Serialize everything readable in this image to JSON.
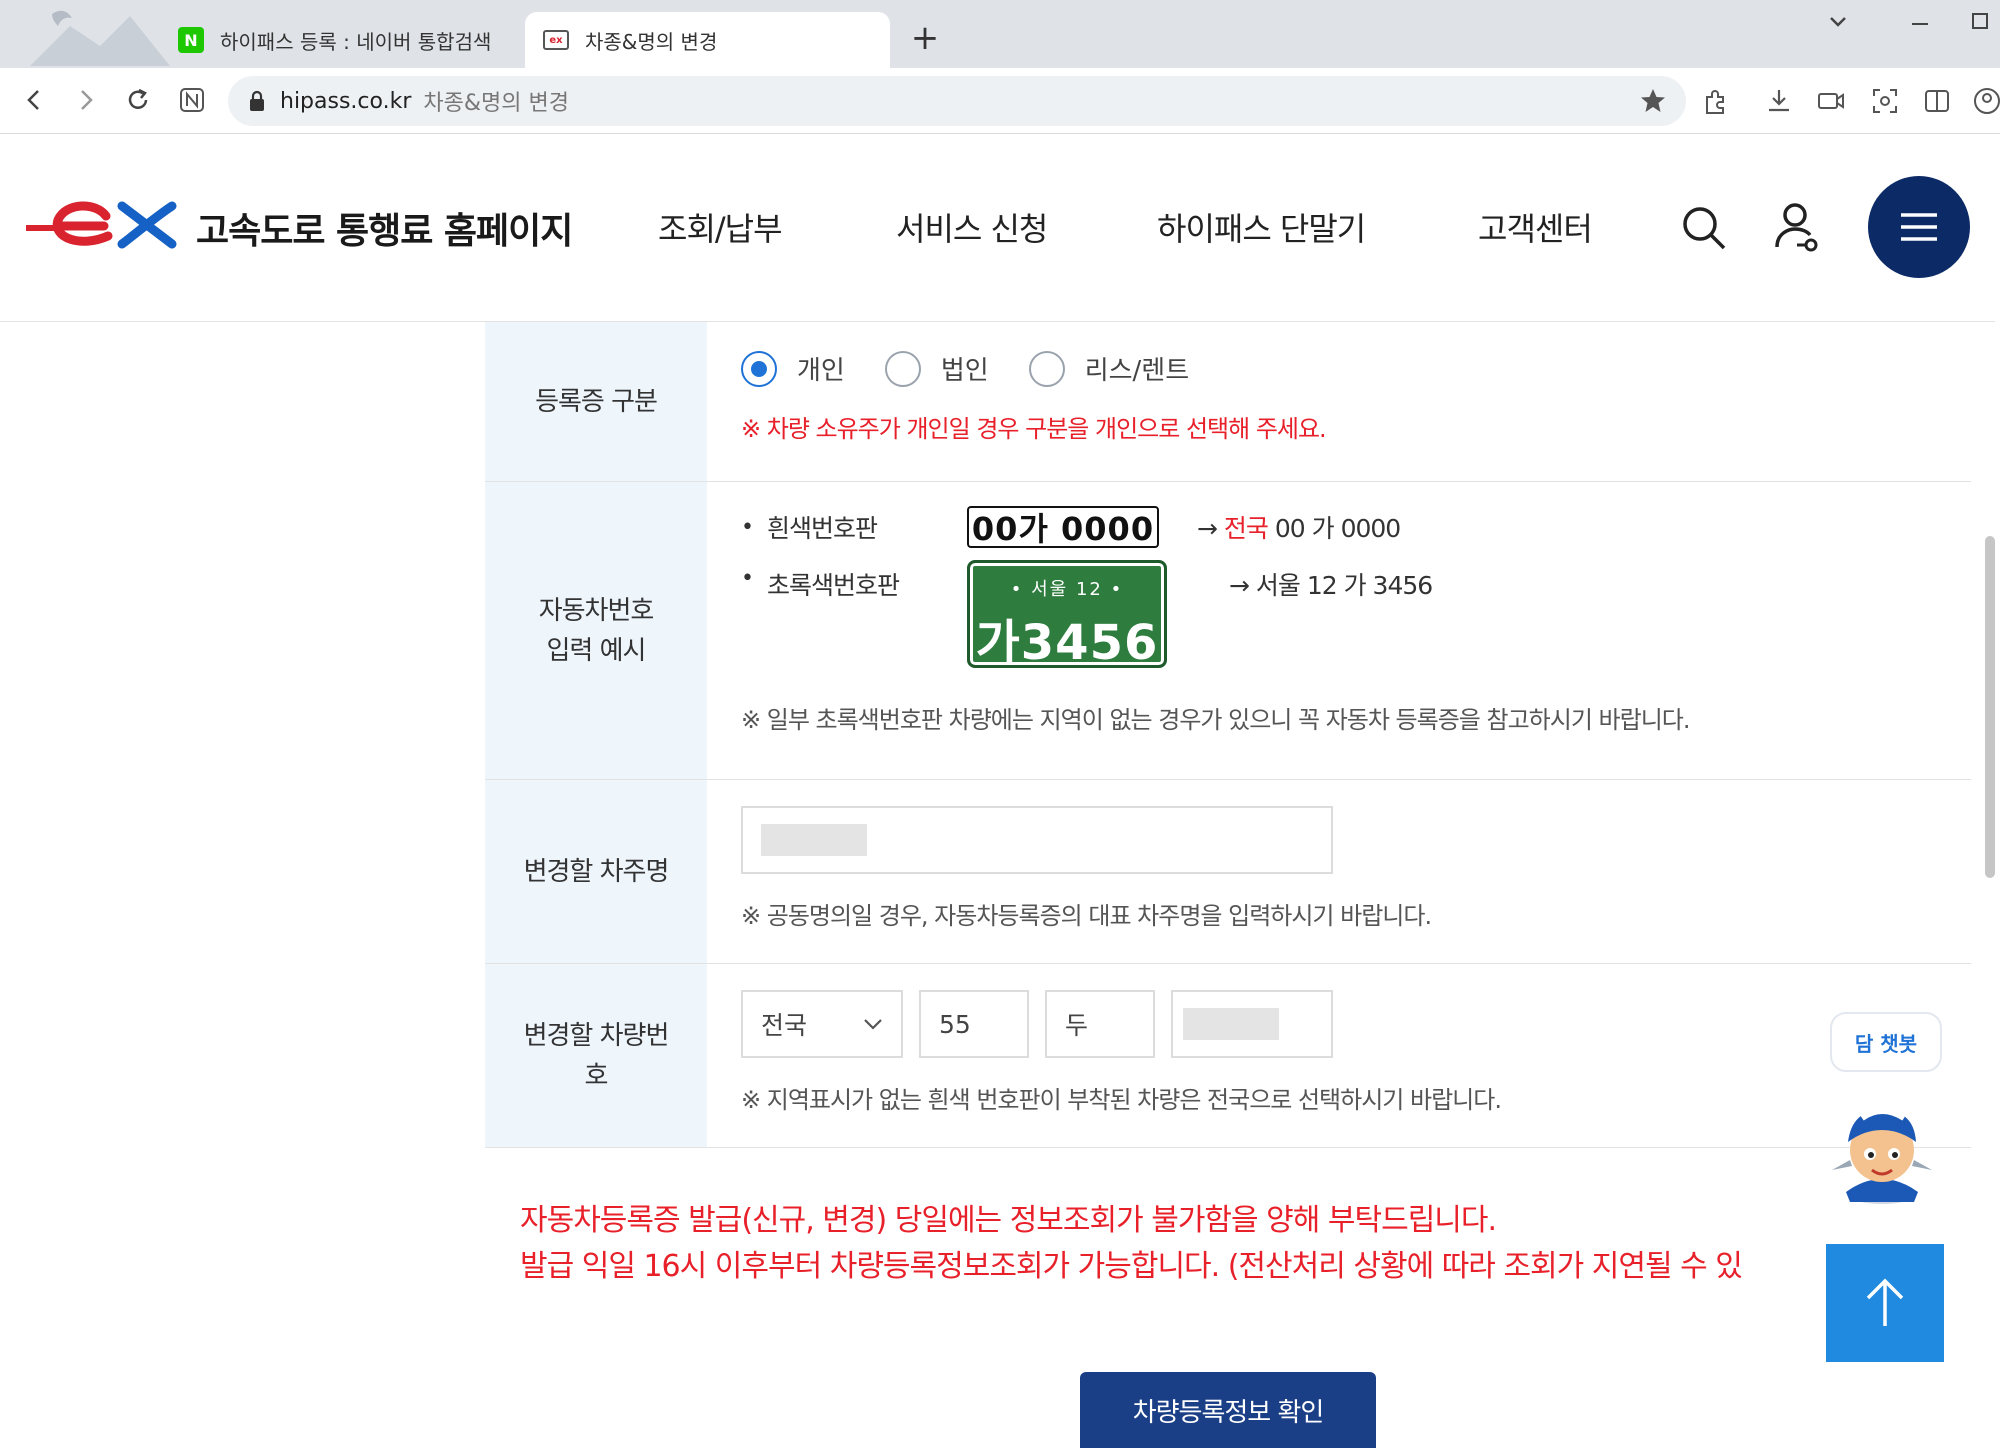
{
  "browser": {
    "tabs": [
      {
        "title": "하이패스 등록 : 네이버 통합검색",
        "favicon": "naver-icon",
        "active": false
      },
      {
        "title": "차종&명의 변경",
        "favicon": "ex-logo-icon",
        "active": true
      }
    ],
    "new_tab": "+",
    "address": {
      "host": "hipass.co.kr",
      "path": "차종&명의 변경"
    }
  },
  "header": {
    "site_title": "고속도로 통행료 홈페이지",
    "nav": [
      "조회/납부",
      "서비스 신청",
      "하이패스 단말기",
      "고객센터"
    ],
    "icons": [
      "search-icon",
      "user-icon",
      "hamburger-menu-icon"
    ],
    "brand_color": "#0c2a66"
  },
  "form": {
    "reg_type": {
      "label": "등록증 구분",
      "options": [
        {
          "label": "개인",
          "checked": true
        },
        {
          "label": "법인",
          "checked": false
        },
        {
          "label": "리스/렌트",
          "checked": false
        }
      ],
      "warning": "※ 차량 소유주가 개인일 경우 구분을 개인으로 선택해 주세요."
    },
    "plate_example": {
      "label_line1": "자동차번호",
      "label_line2": "입력 예시",
      "white": {
        "bullet": "•",
        "label": "흰색번호판",
        "plate": "00가 0000",
        "arrow": "→",
        "result_region": "전국",
        "result_rest": " 00 가 0000"
      },
      "green": {
        "bullet": "•",
        "label": "초록색번호판",
        "plate_top": "• 서울 12 •",
        "plate_bottom": "가3456",
        "arrow": "→",
        "result": " 서울 12 가 3456"
      },
      "note": "※ 일부 초록색번호판 차량에는 지역이 없는 경우가 있으니 꼭 자동차 등록증을 참고하시기 바랍니다."
    },
    "owner": {
      "label": "변경할 차주명",
      "note": "※ 공동명의일 경우, 자동차등록증의 대표 차주명을 입력하시기 바랍니다."
    },
    "vehicle_no": {
      "label_line1": "변경할 차량번",
      "label_line2": "호",
      "region": "전국",
      "num1": "55",
      "hangul": "두",
      "note": "※ 지역표시가 없는 흰색 번호판이 부착된 차량은 전국으로 선택하시기 바랍니다."
    }
  },
  "notice": {
    "line1": "자동차등록증 발급(신규, 변경) 당일에는 정보조회가 불가함을 양해 부탁드립니다.",
    "line2": "발급 익일 16시 이후부터 차량등록정보조회가 가능합니다. (전산처리 상황에 따라 조회가 지연될 수 있"
  },
  "submit_label": "차량등록정보 확인",
  "chatbot_label": "담 챗봇",
  "colors": {
    "warning": "#e8202a",
    "label_bg": "#eef6fc",
    "primary": "#1b3f86",
    "top_button": "#1f8ae0"
  }
}
